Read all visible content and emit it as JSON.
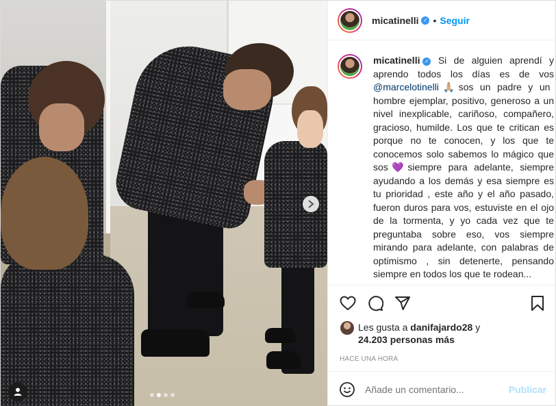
{
  "post": {
    "username": "micatinelli",
    "verified_mark": "✓",
    "separator": "•",
    "follow_label": "Seguir",
    "caption_before_mention": "Si de alguien aprendí y aprendo todos los días es de vos",
    "mention": "@marcelotinelli",
    "emoji_pray": "🙏🏼",
    "caption_middle": "sos un padre y un hombre ejemplar, positivo, generoso a un nivel inexplicable, cariñoso, compañero, gracioso, humilde. Los que te critican es porque no te conocen, y los que te conocemos solo sabemos lo mágico que sos",
    "emoji_heart": "💜",
    "caption_after": "siempre para adelante, siempre ayudando a los demás y esa siempre es tu prioridad , este año y el año pasado, fueron duros para vos, estuviste en el ojo de la tormenta, y yo cada vez que te preguntaba sobre eso, vos siempre mirando para adelante, con palabras de optimismo , sin detenerte, pensando siempre en todos los que te rodean..."
  },
  "actions": {
    "like_icon": "heart-outline-icon",
    "comment_icon": "comment-icon",
    "share_icon": "share-icon",
    "save_icon": "bookmark-icon"
  },
  "likes": {
    "prefix": "Les gusta a",
    "first_user": "danifajardo28",
    "conjunction": "y",
    "count_text": "24.203 personas más"
  },
  "timestamp": "HACE UNA HORA",
  "comment": {
    "placeholder": "Añade un comentario...",
    "publish_label": "Publicar",
    "emoji_icon": "smiley-icon"
  },
  "carousel": {
    "total": 4,
    "active_index": 1
  },
  "colors": {
    "accent": "#0095f6",
    "verified": "#3897f0",
    "publish_disabled": "#b2dffc",
    "muted": "#8e8e8e"
  }
}
